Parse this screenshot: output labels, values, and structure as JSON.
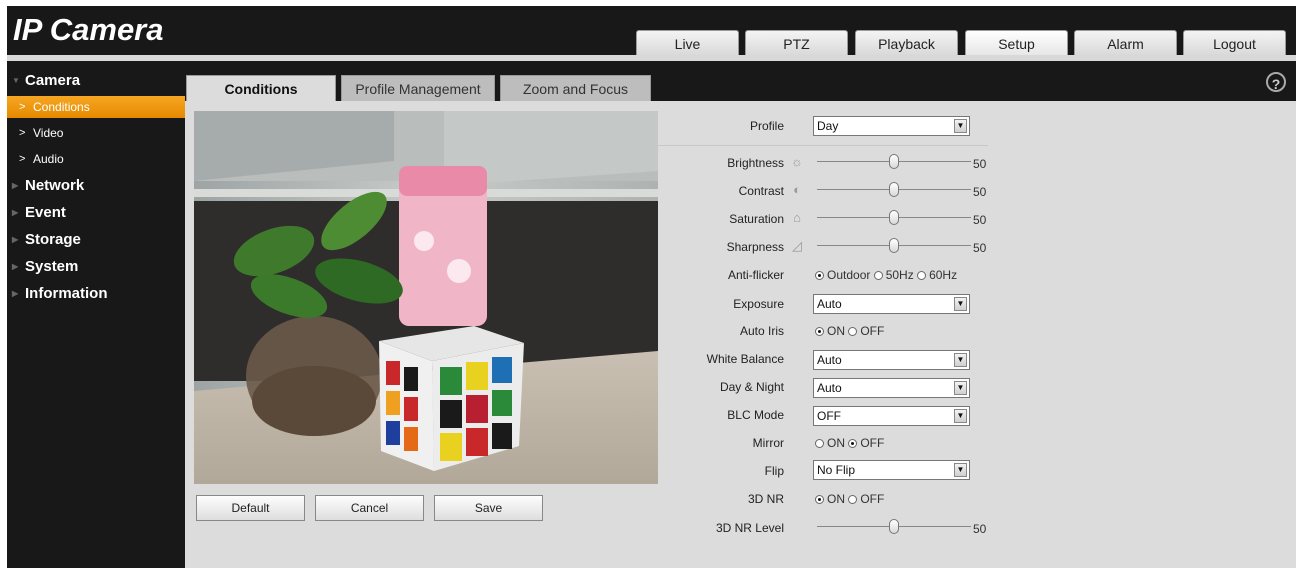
{
  "app": {
    "logo": "IP Camera"
  },
  "topnav": [
    {
      "label": "Live"
    },
    {
      "label": "PTZ"
    },
    {
      "label": "Playback"
    },
    {
      "label": "Setup",
      "active": true
    },
    {
      "label": "Alarm"
    },
    {
      "label": "Logout"
    }
  ],
  "sidebar": {
    "camera": "Camera",
    "conditions": "Conditions",
    "video": "Video",
    "audio": "Audio",
    "network": "Network",
    "event": "Event",
    "storage": "Storage",
    "system": "System",
    "information": "Information"
  },
  "content_tabs": {
    "conditions": "Conditions",
    "profile_management": "Profile Management",
    "zoom_focus": "Zoom and Focus"
  },
  "help": "?",
  "buttons": {
    "default": "Default",
    "cancel": "Cancel",
    "save": "Save"
  },
  "settings": {
    "profile": {
      "label": "Profile",
      "value": "Day"
    },
    "brightness": {
      "label": "Brightness",
      "value": "50",
      "level": 50
    },
    "contrast": {
      "label": "Contrast",
      "value": "50",
      "level": 50
    },
    "saturation": {
      "label": "Saturation",
      "value": "50",
      "level": 50
    },
    "sharpness": {
      "label": "Sharpness",
      "value": "50",
      "level": 50
    },
    "anti_flicker": {
      "label": "Anti-flicker",
      "opt1": "Outdoor",
      "opt2": "50Hz",
      "opt3": "60Hz",
      "selected": "Outdoor"
    },
    "exposure": {
      "label": "Exposure",
      "value": "Auto"
    },
    "auto_iris": {
      "label": "Auto Iris",
      "on": "ON",
      "off": "OFF",
      "selected": "ON"
    },
    "white_balance": {
      "label": "White Balance",
      "value": "Auto"
    },
    "day_night": {
      "label": "Day & Night",
      "value": "Auto"
    },
    "blc_mode": {
      "label": "BLC Mode",
      "value": "OFF"
    },
    "mirror": {
      "label": "Mirror",
      "on": "ON",
      "off": "OFF",
      "selected": "OFF"
    },
    "flip": {
      "label": "Flip",
      "value": "No Flip"
    },
    "nr3d": {
      "label": "3D NR",
      "on": "ON",
      "off": "OFF",
      "selected": "ON"
    },
    "nr3d_level": {
      "label": "3D NR Level",
      "value": "50",
      "level": 50
    }
  },
  "colors": {
    "accent": "#f39c12",
    "header_bg": "#181818",
    "panel_bg": "#dcdcdc"
  }
}
